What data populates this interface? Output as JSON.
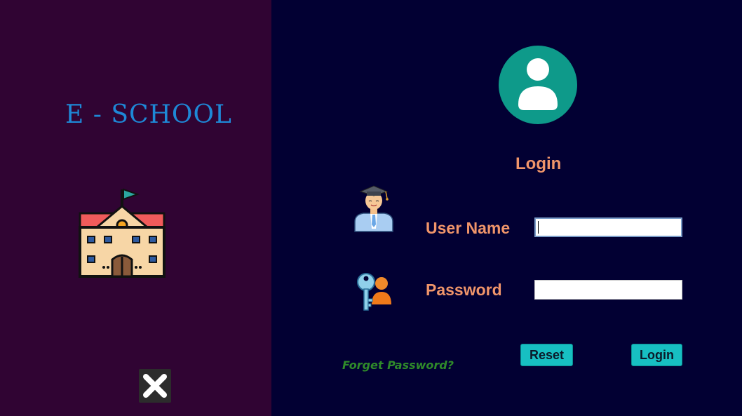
{
  "app": {
    "brand": "E - SCHOOL"
  },
  "login": {
    "title": "Login",
    "username_label": "User Name",
    "password_label": "Password",
    "username_value": "",
    "password_value": "",
    "forgot_label": "Forget Password?",
    "reset_label": "Reset",
    "login_label": "Login"
  },
  "colors": {
    "left_panel_bg": "#300433",
    "right_panel_bg": "#020033",
    "brand_text": "#1e88d6",
    "label_text": "#f0956a",
    "forgot_text": "#2f8a2a",
    "button_bg": "#17bfc2",
    "avatar_bg": "#0e9a8a"
  },
  "icons": {
    "school": "school-building-icon",
    "avatar": "user-avatar-icon",
    "user": "graduate-student-icon",
    "key": "key-user-icon",
    "close": "close-icon"
  }
}
